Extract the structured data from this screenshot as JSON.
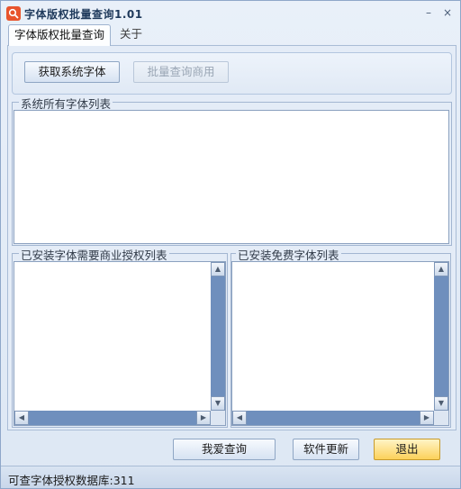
{
  "window": {
    "title": "字体版权批量查询1.01",
    "minimize_glyph": "–",
    "close_glyph": "×"
  },
  "tabs": [
    {
      "label": "字体版权批量查询",
      "active": true
    },
    {
      "label": "关于",
      "active": false
    }
  ],
  "toolbar": {
    "get_fonts_label": "获取系统字体",
    "batch_query_label": "批量查询商用"
  },
  "groups": {
    "all_fonts": "系统所有字体列表",
    "commercial": "已安装字体需要商业授权列表",
    "free": "已安装免费字体列表"
  },
  "scroll_glyphs": {
    "up": "▲",
    "down": "▼",
    "left": "◀",
    "right": "▶"
  },
  "bottom_buttons": {
    "love_query": "我爱查询",
    "update": "软件更新",
    "exit": "退出"
  },
  "status": {
    "text": "可查字体授权数据库:311"
  },
  "icons": {
    "app": "search-icon"
  }
}
